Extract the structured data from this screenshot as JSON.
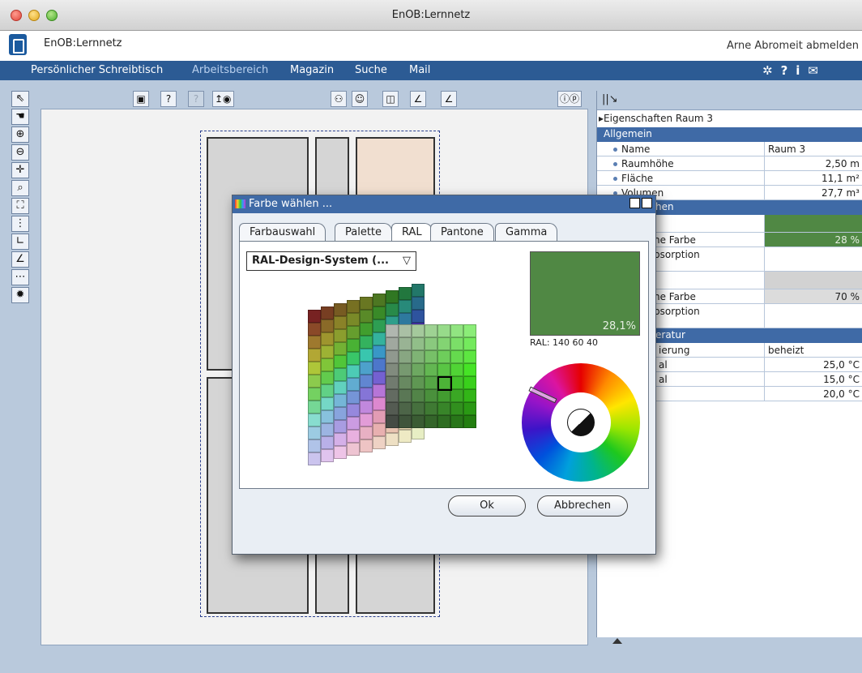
{
  "window": {
    "title": "EnOB:Lernnetz"
  },
  "header": {
    "app_name": "EnOB:Lernnetz",
    "logout_text": "Arne Abromeit abmelden"
  },
  "nav": {
    "items": [
      {
        "label": "Persönlicher Schreibtisch"
      },
      {
        "label": "Arbeitsbereich",
        "active": true
      },
      {
        "label": "Magazin"
      },
      {
        "label": "Suche"
      },
      {
        "label": "Mail"
      }
    ],
    "icons": [
      "gear-icon",
      "help-icon",
      "info-icon",
      "mail-icon"
    ]
  },
  "toolbar": {
    "help_glyph": "?",
    "help_glyph_disabled": "?",
    "coords_glyph": "ⓘⓟ"
  },
  "properties": {
    "title": "Eigenschaften Raum 3",
    "sections": [
      {
        "label": "Allgemein"
      },
      {
        "label": "hen"
      },
      {
        "label": "eratur"
      }
    ],
    "rows": {
      "name_key": "Name",
      "name_val": "Raum 3",
      "height_key": "Raumhöhe",
      "height_val": "2,50 m",
      "area_key": "Fläche",
      "area_val": "11,1 m²",
      "volume_key": "Volumen",
      "volume_val": "27,7 m³",
      "color1_key": "ne Farbe",
      "color1_val": "28 %",
      "absorption1_key": "bsorption",
      "color2_key": "ne Farbe",
      "color2_val": "70 %",
      "absorption2_key": "bsorption",
      "conditioning_key": "ierung",
      "conditioning_val": "beheizt",
      "temp1_key": "al",
      "temp1_val": "25,0 °C",
      "temp2_key": "al",
      "temp2_val": "15,0 °C",
      "temp3_val": "20,0 °C"
    },
    "color_accent": "#508844"
  },
  "dialog": {
    "title": "Farbe wählen ...",
    "tabs": [
      {
        "label": "Farbauswahl"
      },
      {
        "label": "Palette"
      },
      {
        "label": "RAL",
        "active": true
      },
      {
        "label": "Pantone"
      },
      {
        "label": "Gamma"
      }
    ],
    "select_value": "RAL-Design-System (...",
    "swatch_color": "#508844",
    "swatch_percent": "28,1%",
    "ral_code": "RAL: 140 60 40",
    "ok_label": "Ok",
    "cancel_label": "Abbrechen"
  }
}
